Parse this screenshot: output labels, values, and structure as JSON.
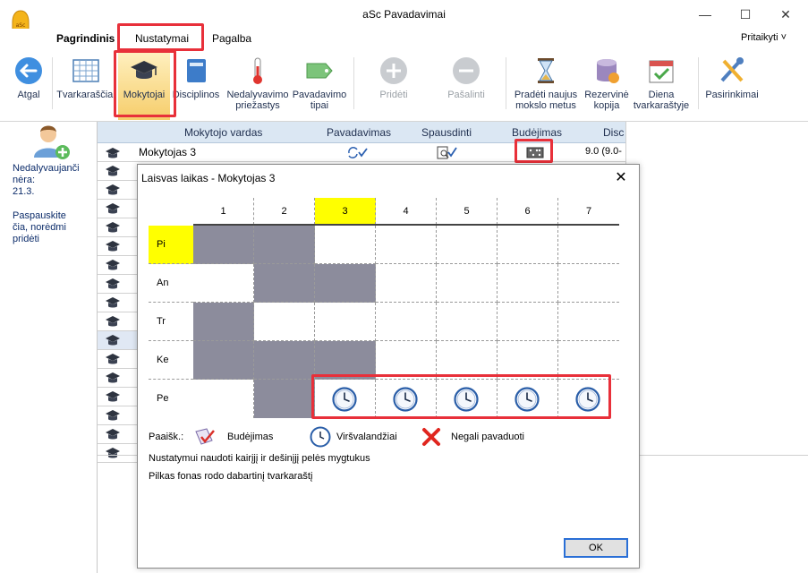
{
  "app": {
    "title": "aSc Pavadavimai"
  },
  "menu": {
    "items": [
      "Pagrindinis",
      "Nustatymai",
      "Pagalba"
    ],
    "right": "Pritaikyti ˅"
  },
  "ribbon": {
    "buttons": [
      {
        "label": "Atgal",
        "icon": "back-arrow-icon"
      },
      {
        "label": "Tvarkaraščiai",
        "icon": "timetable-grid-icon"
      },
      {
        "label": "Mokytojai",
        "icon": "graduation-cap-icon"
      },
      {
        "label": "Disciplinos",
        "icon": "book-icon"
      },
      {
        "label": "Nedalyvavimo\npriežastys",
        "icon": "thermometer-icon"
      },
      {
        "label": "Pavadavimo\ntipai",
        "icon": "tag-icon"
      },
      {
        "label": "Pridėti",
        "icon": "plus-circle-icon"
      },
      {
        "label": "Pašalinti",
        "icon": "minus-circle-icon"
      },
      {
        "label": "Pradėti naujus\nmokslo metus",
        "icon": "hourglass-icon"
      },
      {
        "label": "Rezervinė\nkopija",
        "icon": "database-icon"
      },
      {
        "label": "Diena\ntvarkaraštyje",
        "icon": "calendar-check-icon"
      },
      {
        "label": "Pasirinkimai",
        "icon": "tools-icon"
      }
    ]
  },
  "left_panel": {
    "line1": "Nedalyvaujanči",
    "line2": "nėra:",
    "line3": "21.3.",
    "hint1": "Paspauskite",
    "hint2": "čia, norėdmi",
    "hint3": "pridėti"
  },
  "grid": {
    "headers": [
      "Mokytojo vardas",
      "Pavadavimas",
      "Spausdinti",
      "Budėjimas",
      "Disc"
    ],
    "first_row": {
      "name": "Mokytojas 3",
      "substitution_icon": "refresh-check-icon",
      "print_icon": "print-preview-icon",
      "duty_icon": "domino-icon",
      "disc": "9.0 (9.0-"
    }
  },
  "dialog": {
    "title": "Laisvas laikas - Mokytojas 3",
    "close": "✕",
    "columns": [
      "1",
      "2",
      "3",
      "4",
      "5",
      "6",
      "7"
    ],
    "highlight_column": 2,
    "rows": [
      "Pi",
      "An",
      "Tr",
      "Ke",
      "Pe"
    ],
    "highlight_row": 0,
    "cells": [
      [
        "busy",
        "busy",
        "free",
        "free",
        "free",
        "free",
        "free"
      ],
      [
        "free",
        "busy",
        "busy",
        "free",
        "free",
        "free",
        "free"
      ],
      [
        "busy",
        "free",
        "free",
        "free",
        "free",
        "free",
        "free"
      ],
      [
        "busy",
        "busy",
        "busy",
        "free",
        "free",
        "free",
        "free"
      ],
      [
        "free",
        "busy",
        "clock",
        "clock",
        "clock",
        "clock",
        "clock"
      ]
    ],
    "legend": {
      "title": "Paaišk.:",
      "duty": "Budėjimas",
      "overtime": "Viršvalandžiai",
      "unavailable": "Negali pavaduoti"
    },
    "note1": "Nustatymui naudoti kairįjį ir dešinįjį pelės mygtukus",
    "note2": "Pilkas fonas rodo dabartinį tvarkaraštį",
    "ok": "OK"
  },
  "colors": {
    "highlight": "#ffff00",
    "busy": "#8c8c9c",
    "annotation_red": "#e8303a",
    "header_blue": "#dbe7f3"
  }
}
